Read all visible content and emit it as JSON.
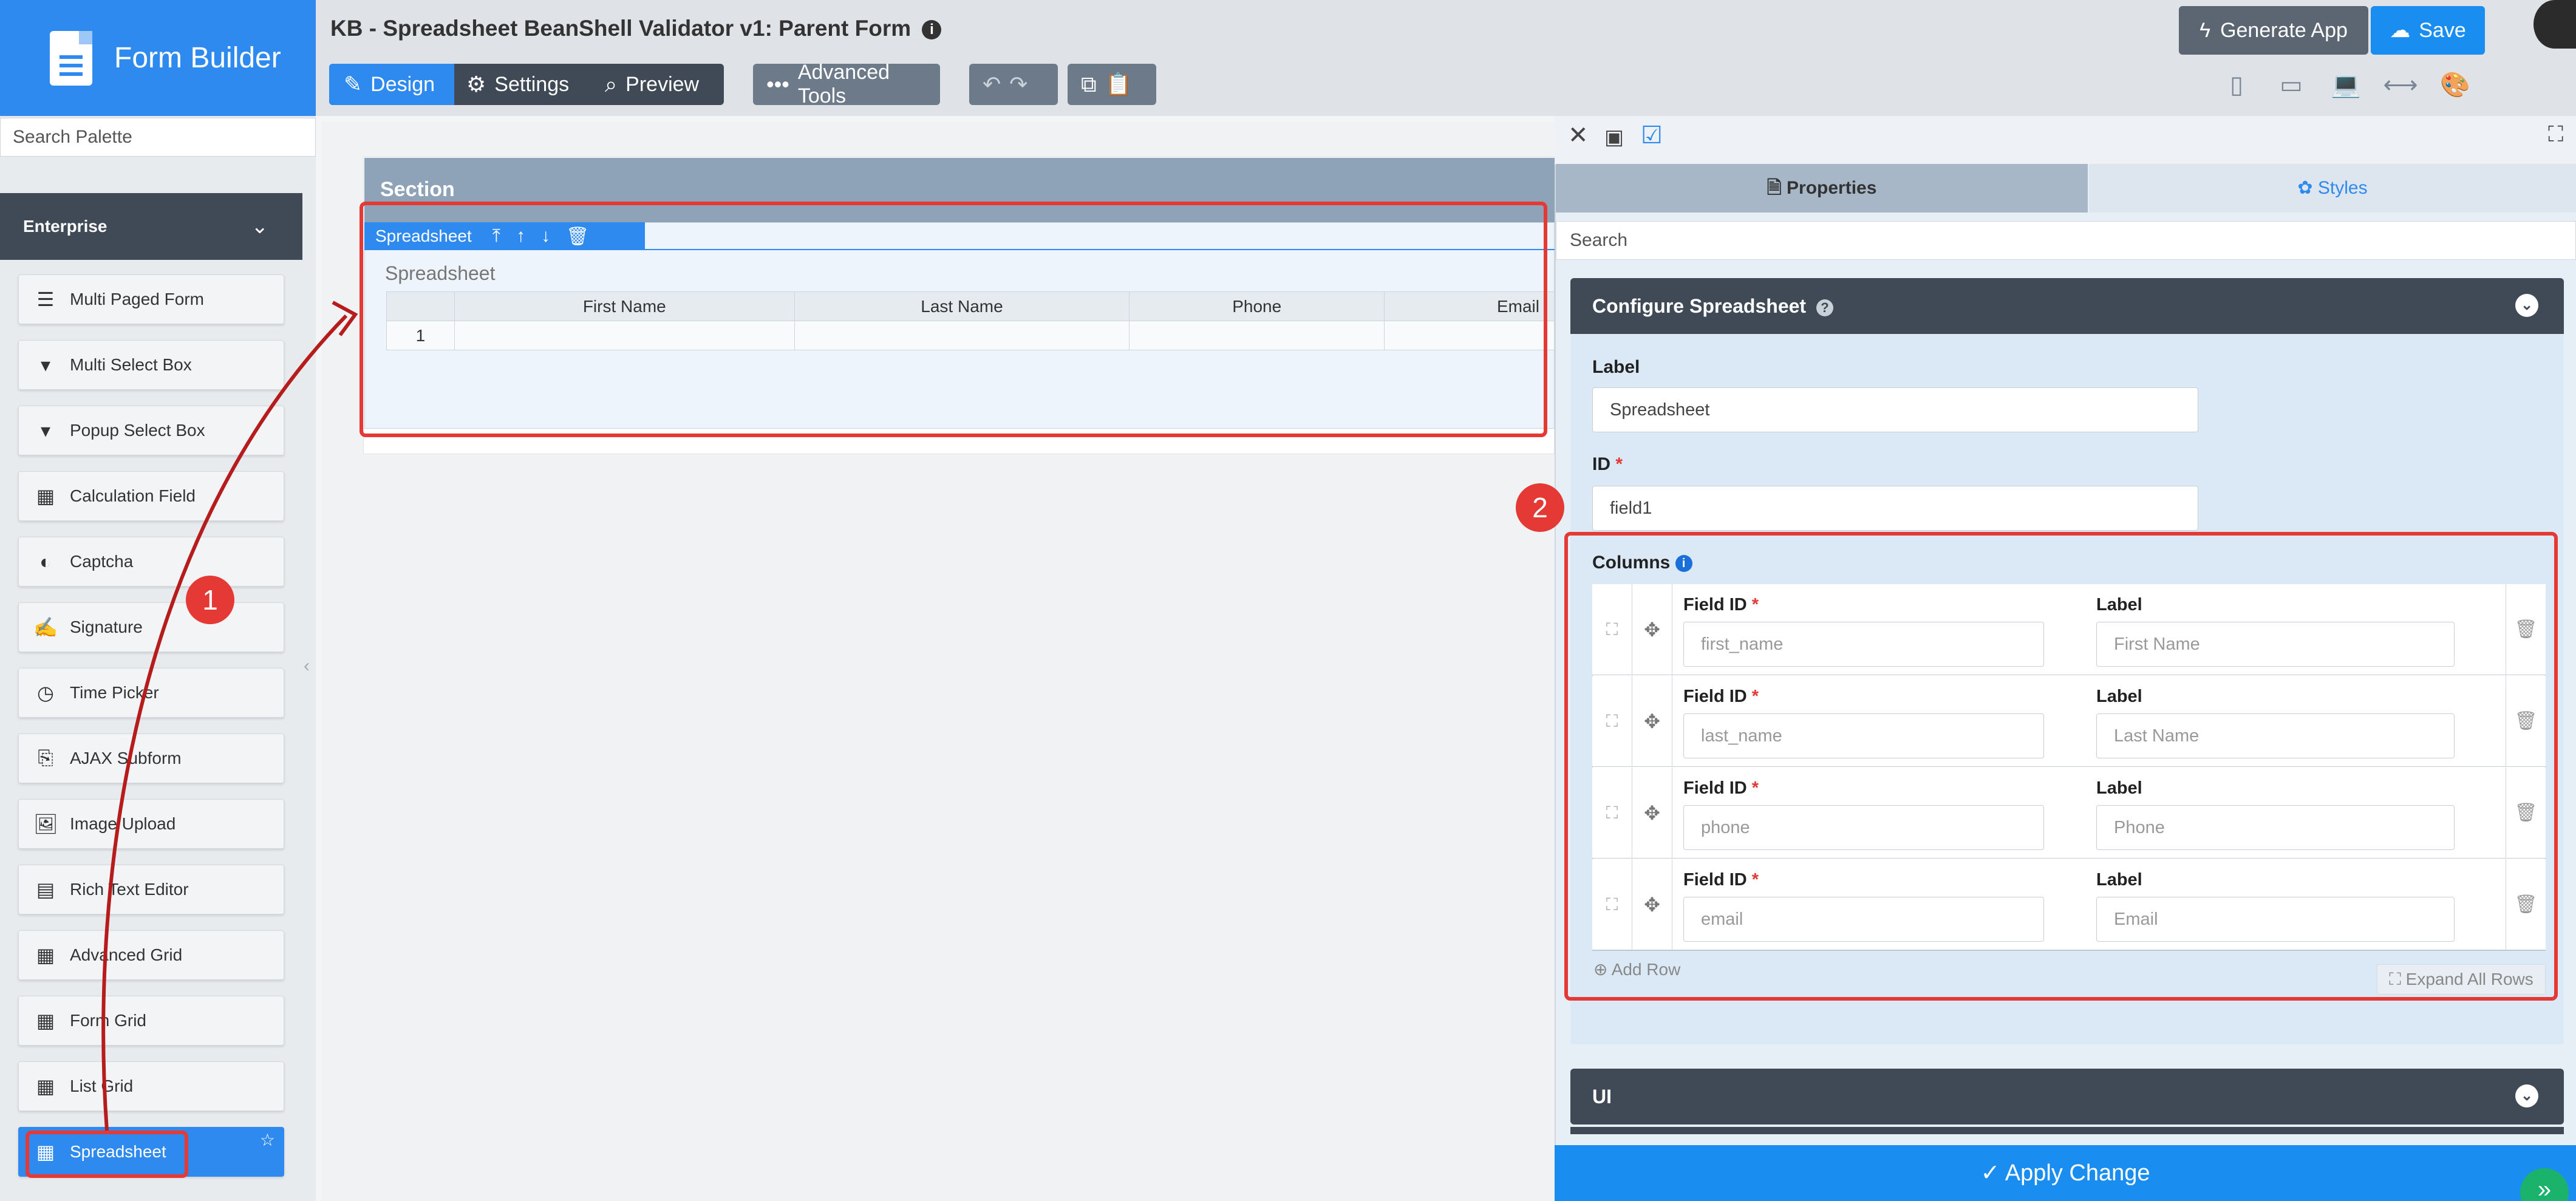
{
  "brand": {
    "title": "Form Builder"
  },
  "form": {
    "title": "KB - Spreadsheet BeanShell Validator v1: Parent Form"
  },
  "toolbar": {
    "design": "Design",
    "settings": "Settings",
    "preview": "Preview",
    "advanced_tools": "Advanced Tools",
    "generate_app": "Generate App",
    "save": "Save"
  },
  "palette": {
    "search_placeholder": "Search Palette",
    "group": "Enterprise",
    "items": [
      {
        "label": "Multi Paged Form"
      },
      {
        "label": "Multi Select Box"
      },
      {
        "label": "Popup Select Box"
      },
      {
        "label": "Calculation Field"
      },
      {
        "label": "Captcha"
      },
      {
        "label": "Signature"
      },
      {
        "label": "Time Picker"
      },
      {
        "label": "AJAX Subform"
      },
      {
        "label": "Image Upload"
      },
      {
        "label": "Rich Text Editor"
      },
      {
        "label": "Advanced Grid"
      },
      {
        "label": "Form Grid"
      },
      {
        "label": "List Grid"
      },
      {
        "label": "Spreadsheet"
      }
    ]
  },
  "canvas": {
    "section_title": "Section",
    "element_type": "Spreadsheet",
    "element_label": "Spreadsheet",
    "columns": [
      "First Name",
      "Last Name",
      "Phone",
      "Email"
    ],
    "row_number": "1"
  },
  "properties": {
    "tab_properties": "Properties",
    "tab_styles": "Styles",
    "search_placeholder": "Search",
    "config_title": "Configure Spreadsheet",
    "label_label": "Label",
    "label_value": "Spreadsheet",
    "id_label": "ID",
    "id_value": "field1",
    "columns_label": "Columns",
    "field_id_label": "Field ID",
    "col_label_label": "Label",
    "rows": [
      {
        "field_id": "first_name",
        "label": "First Name"
      },
      {
        "field_id": "last_name",
        "label": "Last Name"
      },
      {
        "field_id": "phone",
        "label": "Phone"
      },
      {
        "field_id": "email",
        "label": "Email"
      }
    ],
    "add_row": "Add Row",
    "expand_all": "Expand All Rows",
    "ui_section": "UI",
    "apply": "Apply Change"
  },
  "annotations": {
    "step1": "1",
    "step2": "2"
  },
  "colors": {
    "accent": "#2f8af0",
    "annotation": "#e53935",
    "dark": "#3f4a56"
  }
}
